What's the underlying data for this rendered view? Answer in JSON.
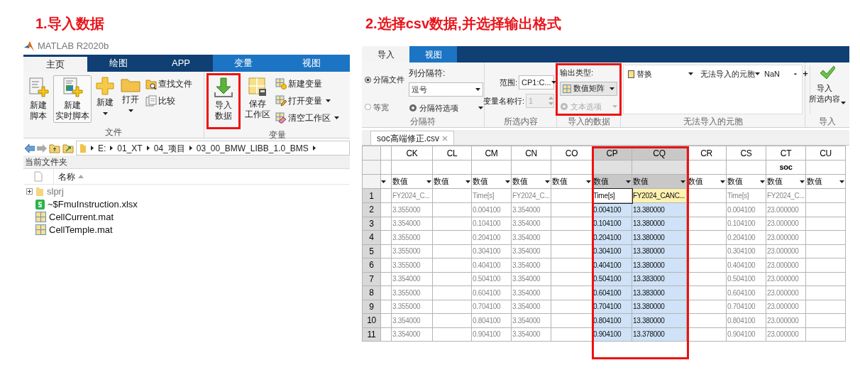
{
  "headings": [
    "1.导入数据",
    "2.选择csv数据,并选择输出格式"
  ],
  "matlab_window": {
    "title": "MATLAB R2020b",
    "tabs": [
      {
        "label": "主页",
        "selected": true,
        "kind": "main"
      },
      {
        "label": "绘图",
        "selected": false,
        "kind": "main"
      },
      {
        "label": "APP",
        "selected": false,
        "kind": "main"
      },
      {
        "label": "变量",
        "selected": false,
        "kind": "contextual"
      },
      {
        "label": "视图",
        "selected": false,
        "kind": "contextual"
      }
    ],
    "toolstrip": [
      {
        "label": "文件",
        "items": [
          {
            "lines": [
              "新建",
              "脚本"
            ],
            "kind": "large",
            "highlighted": false
          },
          {
            "lines": [
              "新建",
              "实时脚本"
            ],
            "kind": "large",
            "highlighted": true
          },
          {
            "lines": [
              "新建"
            ],
            "kind": "large-menu",
            "highlighted": false
          },
          {
            "lines": [
              "打开"
            ],
            "kind": "large-menu",
            "highlighted": false
          },
          {
            "label": "查找文件",
            "kind": "small",
            "highlighted": false
          },
          {
            "label": "比较",
            "kind": "small",
            "highlighted": false
          }
        ]
      },
      {
        "label": "变量",
        "items": [
          {
            "lines": [
              "导入",
              "数据"
            ],
            "kind": "large",
            "highlighted": false
          },
          {
            "lines": [
              "保存",
              "工作区"
            ],
            "kind": "large",
            "highlighted": false
          },
          {
            "label": "新建变量",
            "kind": "small",
            "highlighted": false
          },
          {
            "label": "打开变量",
            "kind": "small-menu",
            "highlighted": false
          },
          {
            "label": "清空工作区",
            "kind": "small-menu",
            "highlighted": false
          }
        ]
      }
    ],
    "path": [
      "E:",
      "01_XT",
      "04_项目",
      "03_00_BMW_LIBB_1.0_BMS"
    ],
    "current_folder": {
      "title": "当前文件夹",
      "column": "名称",
      "files": [
        {
          "name": "slprj",
          "kind": "folder",
          "expanded": false
        },
        {
          "name": "~$FmuInstruction.xlsx",
          "kind": "spreadsheet"
        },
        {
          "name": "CellCurrent.mat",
          "kind": "mat"
        },
        {
          "name": "CellTemple.mat",
          "kind": "mat"
        }
      ]
    }
  },
  "import_tool": {
    "tabs": [
      {
        "label": "导入",
        "selected": true
      },
      {
        "label": "视图",
        "selected": false
      }
    ],
    "delimiter_group": {
      "label": "分隔符",
      "modes": [
        {
          "label": "分隔文件",
          "selected": true
        },
        {
          "label": "等宽",
          "selected": false
        }
      ],
      "column_delimiter_label": "列分隔符:",
      "column_delimiter": "逗号",
      "options_button": "分隔符选项"
    },
    "selection_group": {
      "label": "所选内容",
      "range_label": "范围:",
      "range": "CP1:C...",
      "name_row_label": "变量名称行:",
      "name_row": "1",
      "name_row_disabled": true
    },
    "output_group": {
      "label": "导入的数据",
      "type_label": "输出类型:",
      "type": "数值矩阵",
      "text_options": "文本选项",
      "text_options_disabled": true
    },
    "unimportable_group": {
      "label": "无法导入的元胞",
      "action": "替换",
      "target": "无法导入的元胞",
      "value": "NaN",
      "remove": "-",
      "add": "+"
    },
    "import_group": {
      "label": "导入",
      "button": [
        "导入",
        "所选内容"
      ]
    },
    "file_tab": "soc高端修正.csv",
    "grid": {
      "columns": [
        {
          "letter": "CK",
          "type": "数值",
          "selected": false,
          "current": false
        },
        {
          "letter": "CL",
          "type": "数值",
          "selected": false,
          "current": false
        },
        {
          "letter": "CM",
          "type": "数值",
          "selected": false,
          "current": false
        },
        {
          "letter": "CN",
          "type": "数值",
          "selected": false,
          "current": false
        },
        {
          "letter": "CO",
          "type": "数值",
          "selected": false,
          "current": false
        },
        {
          "letter": "CP",
          "type": "数值",
          "selected": true,
          "current": false
        },
        {
          "letter": "CQ",
          "type": "数值",
          "selected": true,
          "current": true
        },
        {
          "letter": "CR",
          "type": "数值",
          "selected": false,
          "current": false
        },
        {
          "letter": "CS",
          "type": "数值",
          "selected": false,
          "current": false
        },
        {
          "letter": "CT",
          "type": "数值",
          "selected": false,
          "current": false,
          "name": "soc"
        },
        {
          "letter": "CU",
          "type": "数值",
          "selected": false,
          "current": false
        }
      ],
      "rows": [
        {
          "number": "1",
          "cells": [
            "FY2024_C...",
            null,
            "Time[s]",
            "FY2024_C...",
            null,
            "Time[s]",
            "FY2024_CANC...",
            null,
            "Time[s]",
            "FY2024_C...",
            null
          ]
        },
        {
          "number": "2",
          "cells": [
            "3.355000",
            null,
            "0.004100",
            "3.354000",
            null,
            "0.004100",
            "13.380000",
            null,
            "0.004100",
            "23.000000",
            null
          ]
        },
        {
          "number": "3",
          "cells": [
            "3.354000",
            null,
            "0.104100",
            "3.354000",
            null,
            "0.104100",
            "13.380000",
            null,
            "0.104100",
            "23.000000",
            null
          ]
        },
        {
          "number": "4",
          "cells": [
            "3.355000",
            null,
            "0.204100",
            "3.354000",
            null,
            "0.204100",
            "13.380000",
            null,
            "0.204100",
            "23.000000",
            null
          ]
        },
        {
          "number": "5",
          "cells": [
            "3.355000",
            null,
            "0.304100",
            "3.354000",
            null,
            "0.304100",
            "13.380000",
            null,
            "0.304100",
            "23.000000",
            null
          ]
        },
        {
          "number": "6",
          "cells": [
            "3.355000",
            null,
            "0.404100",
            "3.354000",
            null,
            "0.404100",
            "13.380000",
            null,
            "0.404100",
            "23.000000",
            null
          ]
        },
        {
          "number": "7",
          "cells": [
            "3.354000",
            null,
            "0.504100",
            "3.354000",
            null,
            "0.504100",
            "13.383000",
            null,
            "0.504100",
            "23.000000",
            null
          ]
        },
        {
          "number": "8",
          "cells": [
            "3.355000",
            null,
            "0.604100",
            "3.354000",
            null,
            "0.604100",
            "13.383000",
            null,
            "0.604100",
            "23.000000",
            null
          ]
        },
        {
          "number": "9",
          "cells": [
            "3.355000",
            null,
            "0.704100",
            "3.354000",
            null,
            "0.704100",
            "13.380000",
            null,
            "0.704100",
            "23.000000",
            null
          ]
        },
        {
          "number": "10",
          "cells": [
            "3.354000",
            null,
            "0.804100",
            "3.354000",
            null,
            "0.804100",
            "13.380000",
            null,
            "0.804100",
            "23.000000",
            null
          ]
        },
        {
          "number": "11",
          "cells": [
            "3.354000",
            null,
            "0.904100",
            "3.354000",
            null,
            "0.904100",
            "13.378000",
            null,
            "0.904100",
            "23.000000",
            null
          ]
        }
      ]
    }
  }
}
